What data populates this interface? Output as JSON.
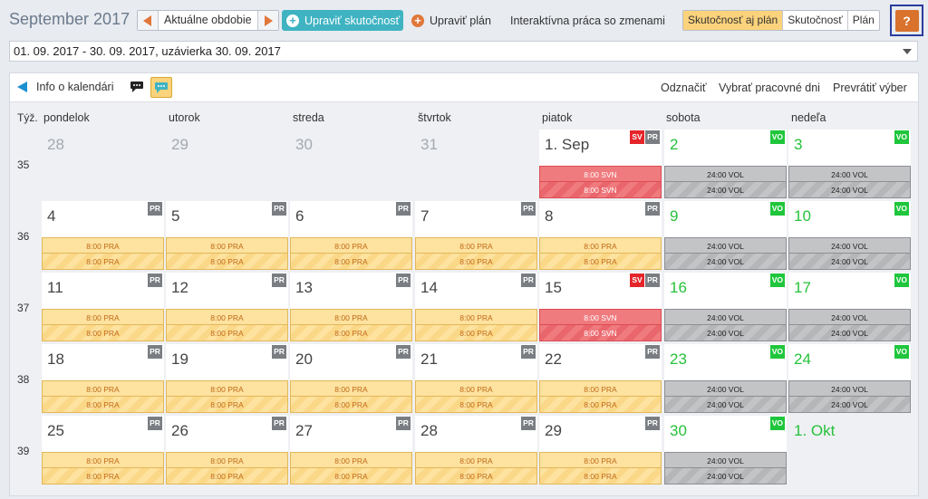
{
  "header": {
    "title": "September 2017",
    "nav_current_label": "Aktuálne obdobie",
    "edit_actual_label": "Upraviť skutočnosť",
    "edit_plan_label": "Upraviť plán",
    "interactive_label": "Interaktívna práca so zmenami",
    "view_modes": [
      {
        "label": "Skutočnosť aj plán",
        "active": true
      },
      {
        "label": "Skutočnosť",
        "active": false
      },
      {
        "label": "Plán",
        "active": false
      }
    ],
    "help_label": "?"
  },
  "period": {
    "value": "01. 09. 2017 - 30. 09. 2017, uzávierka 30. 09. 2017"
  },
  "calendar_toolbar": {
    "info_label": "Info o kalendári",
    "deselect_label": "Odznačiť",
    "select_workdays_label": "Vybrať pracovné dni",
    "invert_label": "Prevrátiť výber"
  },
  "calendar": {
    "week_col_label": "Týž.",
    "weekdays": [
      "pondelok",
      "utorok",
      "streda",
      "štvrtok",
      "piatok",
      "sobota",
      "nedeľa"
    ],
    "weeks": [
      {
        "number": "35",
        "days": [
          {
            "label": "28",
            "style": "muted",
            "badges": [],
            "bars": null
          },
          {
            "label": "29",
            "style": "muted",
            "badges": [],
            "bars": null
          },
          {
            "label": "30",
            "style": "muted",
            "badges": [],
            "bars": null
          },
          {
            "label": "31",
            "style": "muted",
            "badges": [],
            "bars": null
          },
          {
            "label": "1. Sep",
            "style": "normal",
            "badges": [
              "SV",
              "PR"
            ],
            "bars": {
              "kind": "svn",
              "top": "8:00 SVN",
              "bottom": "8:00 SVN"
            }
          },
          {
            "label": "2",
            "style": "green",
            "badges": [
              "VO"
            ],
            "bars": {
              "kind": "vol",
              "top": "24:00 VOL",
              "bottom": "24:00 VOL"
            }
          },
          {
            "label": "3",
            "style": "green",
            "badges": [
              "VO"
            ],
            "bars": {
              "kind": "vol",
              "top": "24:00 VOL",
              "bottom": "24:00 VOL"
            }
          }
        ]
      },
      {
        "number": "36",
        "days": [
          {
            "label": "4",
            "style": "normal",
            "badges": [
              "PR"
            ],
            "bars": {
              "kind": "pra",
              "top": "8:00 PRA",
              "bottom": "8:00 PRA"
            }
          },
          {
            "label": "5",
            "style": "normal",
            "badges": [
              "PR"
            ],
            "bars": {
              "kind": "pra",
              "top": "8:00 PRA",
              "bottom": "8:00 PRA"
            }
          },
          {
            "label": "6",
            "style": "normal",
            "badges": [
              "PR"
            ],
            "bars": {
              "kind": "pra",
              "top": "8:00 PRA",
              "bottom": "8:00 PRA"
            }
          },
          {
            "label": "7",
            "style": "normal",
            "badges": [
              "PR"
            ],
            "bars": {
              "kind": "pra",
              "top": "8:00 PRA",
              "bottom": "8:00 PRA"
            }
          },
          {
            "label": "8",
            "style": "normal",
            "badges": [
              "PR"
            ],
            "bars": {
              "kind": "pra",
              "top": "8:00 PRA",
              "bottom": "8:00 PRA"
            }
          },
          {
            "label": "9",
            "style": "green",
            "badges": [
              "VO"
            ],
            "bars": {
              "kind": "vol",
              "top": "24:00 VOL",
              "bottom": "24:00 VOL"
            }
          },
          {
            "label": "10",
            "style": "green",
            "badges": [
              "VO"
            ],
            "bars": {
              "kind": "vol",
              "top": "24:00 VOL",
              "bottom": "24:00 VOL"
            }
          }
        ]
      },
      {
        "number": "37",
        "days": [
          {
            "label": "11",
            "style": "normal",
            "badges": [
              "PR"
            ],
            "bars": {
              "kind": "pra",
              "top": "8:00 PRA",
              "bottom": "8:00 PRA"
            }
          },
          {
            "label": "12",
            "style": "normal",
            "badges": [
              "PR"
            ],
            "bars": {
              "kind": "pra",
              "top": "8:00 PRA",
              "bottom": "8:00 PRA"
            }
          },
          {
            "label": "13",
            "style": "normal",
            "badges": [
              "PR"
            ],
            "bars": {
              "kind": "pra",
              "top": "8:00 PRA",
              "bottom": "8:00 PRA"
            }
          },
          {
            "label": "14",
            "style": "normal",
            "badges": [
              "PR"
            ],
            "bars": {
              "kind": "pra",
              "top": "8:00 PRA",
              "bottom": "8:00 PRA"
            }
          },
          {
            "label": "15",
            "style": "normal",
            "badges": [
              "SV",
              "PR"
            ],
            "bars": {
              "kind": "svn",
              "top": "8:00 SVN",
              "bottom": "8:00 SVN"
            }
          },
          {
            "label": "16",
            "style": "green",
            "badges": [
              "VO"
            ],
            "bars": {
              "kind": "vol",
              "top": "24:00 VOL",
              "bottom": "24:00 VOL"
            }
          },
          {
            "label": "17",
            "style": "green",
            "badges": [
              "VO"
            ],
            "bars": {
              "kind": "vol",
              "top": "24:00 VOL",
              "bottom": "24:00 VOL"
            }
          }
        ]
      },
      {
        "number": "38",
        "days": [
          {
            "label": "18",
            "style": "normal",
            "badges": [
              "PR"
            ],
            "bars": {
              "kind": "pra",
              "top": "8:00 PRA",
              "bottom": "8:00 PRA"
            }
          },
          {
            "label": "19",
            "style": "normal",
            "badges": [
              "PR"
            ],
            "bars": {
              "kind": "pra",
              "top": "8:00 PRA",
              "bottom": "8:00 PRA"
            }
          },
          {
            "label": "20",
            "style": "normal",
            "badges": [
              "PR"
            ],
            "bars": {
              "kind": "pra",
              "top": "8:00 PRA",
              "bottom": "8:00 PRA"
            }
          },
          {
            "label": "21",
            "style": "normal",
            "badges": [
              "PR"
            ],
            "bars": {
              "kind": "pra",
              "top": "8:00 PRA",
              "bottom": "8:00 PRA"
            }
          },
          {
            "label": "22",
            "style": "normal",
            "badges": [
              "PR"
            ],
            "bars": {
              "kind": "pra",
              "top": "8:00 PRA",
              "bottom": "8:00 PRA"
            }
          },
          {
            "label": "23",
            "style": "green",
            "badges": [
              "VO"
            ],
            "bars": {
              "kind": "vol",
              "top": "24:00 VOL",
              "bottom": "24:00 VOL"
            }
          },
          {
            "label": "24",
            "style": "green",
            "badges": [
              "VO"
            ],
            "bars": {
              "kind": "vol",
              "top": "24:00 VOL",
              "bottom": "24:00 VOL"
            }
          }
        ]
      },
      {
        "number": "39",
        "days": [
          {
            "label": "25",
            "style": "normal",
            "badges": [
              "PR"
            ],
            "bars": {
              "kind": "pra",
              "top": "8:00 PRA",
              "bottom": "8:00 PRA"
            }
          },
          {
            "label": "26",
            "style": "normal",
            "badges": [
              "PR"
            ],
            "bars": {
              "kind": "pra",
              "top": "8:00 PRA",
              "bottom": "8:00 PRA"
            }
          },
          {
            "label": "27",
            "style": "normal",
            "badges": [
              "PR"
            ],
            "bars": {
              "kind": "pra",
              "top": "8:00 PRA",
              "bottom": "8:00 PRA"
            }
          },
          {
            "label": "28",
            "style": "normal",
            "badges": [
              "PR"
            ],
            "bars": {
              "kind": "pra",
              "top": "8:00 PRA",
              "bottom": "8:00 PRA"
            }
          },
          {
            "label": "29",
            "style": "normal",
            "badges": [
              "PR"
            ],
            "bars": {
              "kind": "pra",
              "top": "8:00 PRA",
              "bottom": "8:00 PRA"
            }
          },
          {
            "label": "30",
            "style": "green",
            "badges": [
              "VO"
            ],
            "bars": {
              "kind": "vol",
              "top": "24:00 VOL",
              "bottom": "24:00 VOL"
            }
          },
          {
            "label": "1. Okt",
            "style": "green",
            "badges": [],
            "bars": null
          }
        ]
      }
    ]
  },
  "colors": {
    "accent_teal": "#3fb3c2",
    "accent_orange": "#e0773b",
    "work_bar": "#fde2a0",
    "off_bar": "#c3c4c6",
    "holiday_bar": "#f07b7f",
    "weekend_green": "#27c13a"
  },
  "icons": [
    "arrow-left-icon",
    "arrow-right-icon",
    "plus-circle-icon",
    "triangle-left-icon",
    "speech-bubble-icon",
    "comment-icon",
    "help-icon",
    "dropdown-caret-icon"
  ]
}
